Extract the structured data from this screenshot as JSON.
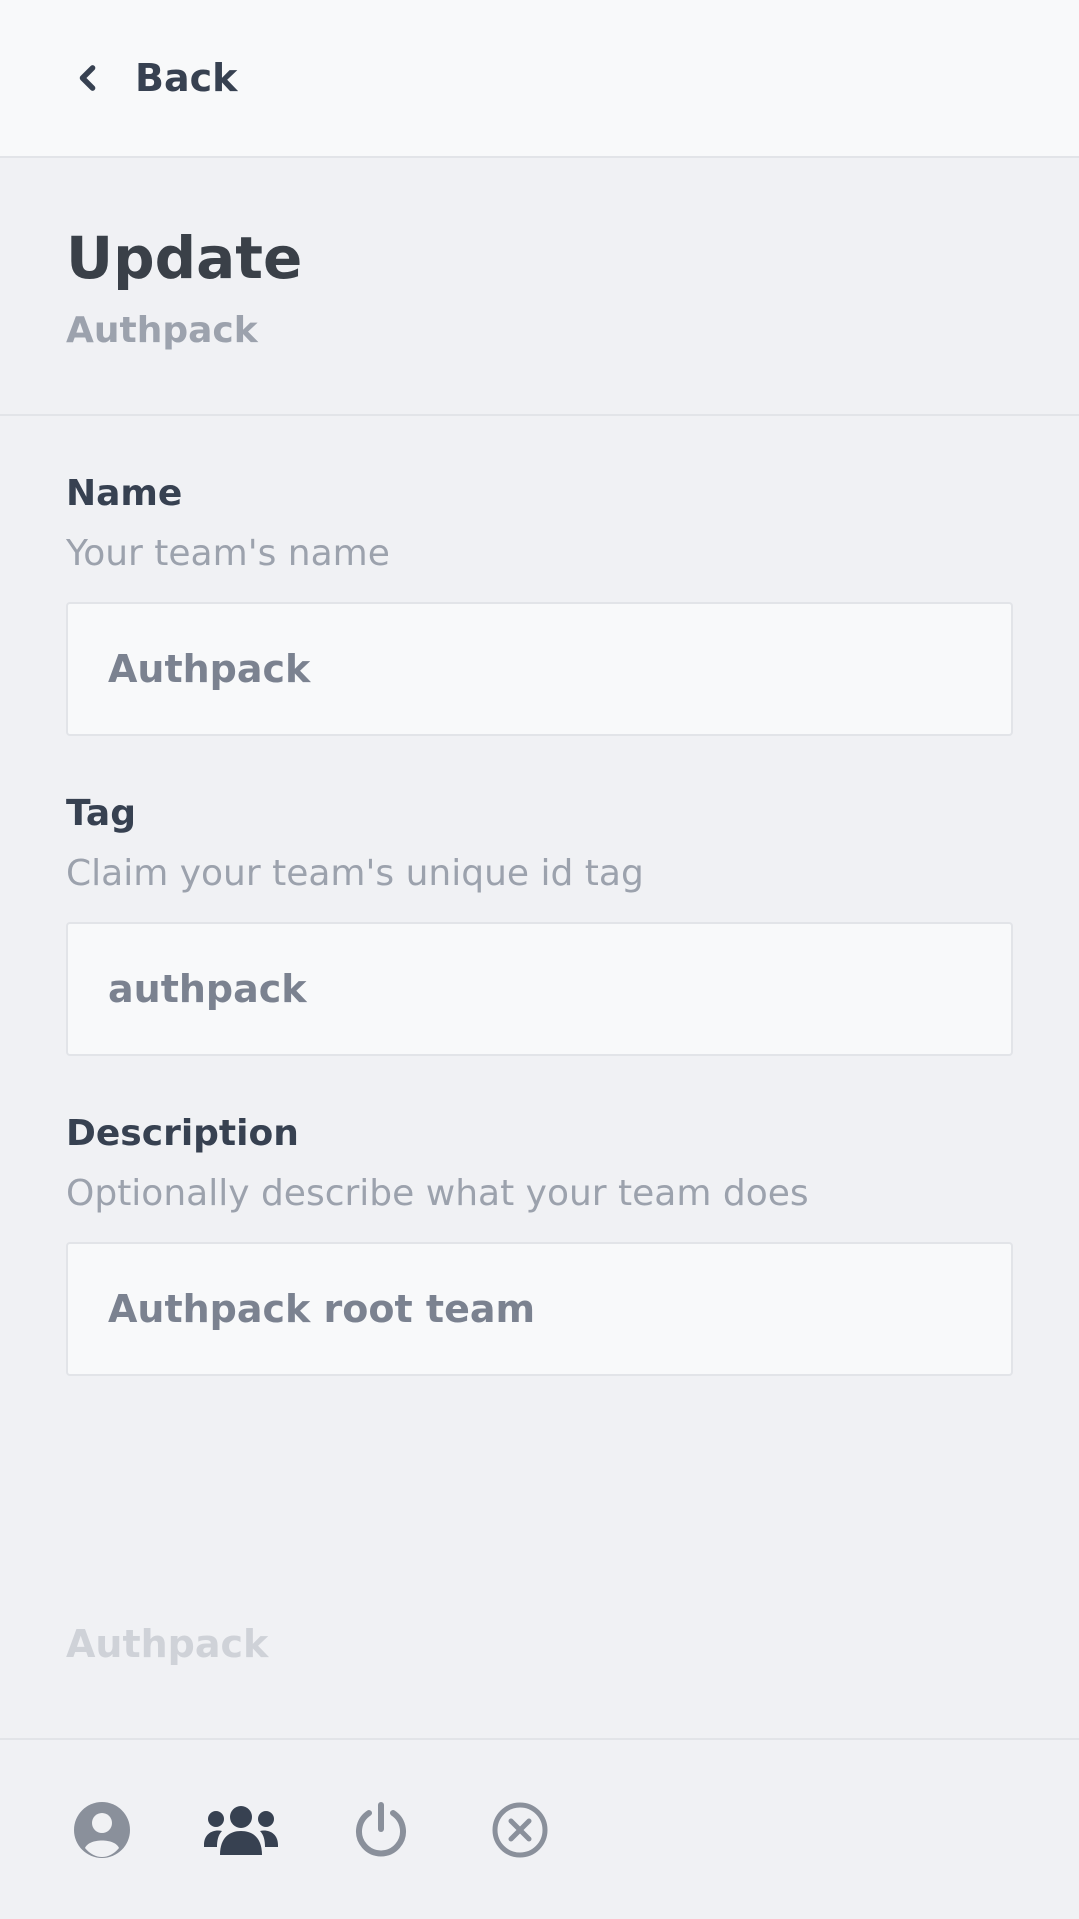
{
  "nav": {
    "back_label": "Back"
  },
  "header": {
    "title": "Update",
    "subtitle": "Authpack"
  },
  "form": {
    "name": {
      "label": "Name",
      "help": "Your team's name",
      "value": "Authpack"
    },
    "tag": {
      "label": "Tag",
      "help": "Claim your team's unique id tag",
      "value": "authpack"
    },
    "description": {
      "label": "Description",
      "help": "Optionally describe what your team does",
      "value": "Authpack root team"
    }
  },
  "footer": {
    "brand": "Authpack"
  },
  "bottom_nav": {
    "icons": [
      "user-circle-icon",
      "users-icon",
      "power-icon",
      "close-circle-icon"
    ]
  },
  "colors": {
    "background": "#f0f1f4",
    "topbar": "#f8f9fa",
    "text_dark": "#374151",
    "text_muted": "#9ca2ad",
    "icon_muted": "#8a909b"
  }
}
